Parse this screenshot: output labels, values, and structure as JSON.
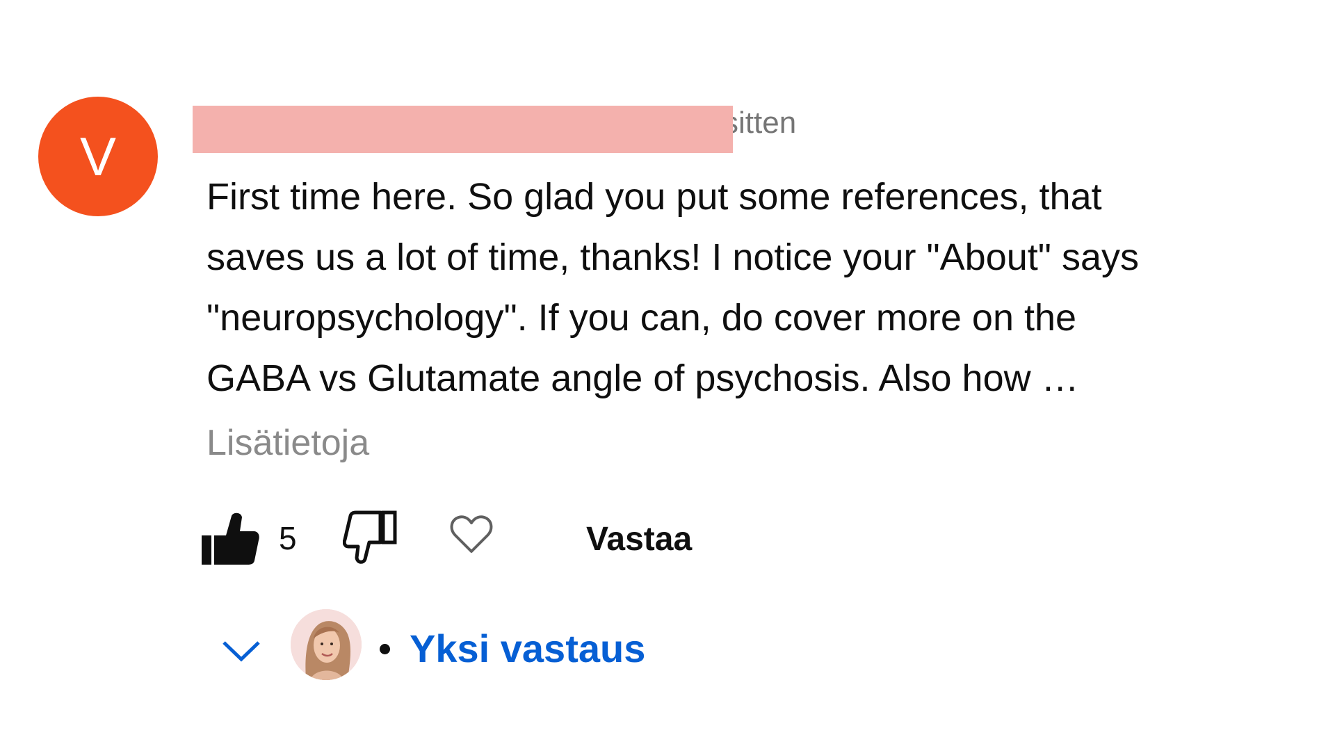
{
  "comment": {
    "avatar_letter": "V",
    "avatar_color": "#f4511e",
    "meta_visible_fragment": "sitten",
    "text": "First time here. So glad you put some references, that\nsaves us a lot of time, thanks! I notice your \"About\" says\n\"neuropsychology\". If you can, do cover more on the\nGABA vs Glutamate angle of psychosis. Also how …",
    "read_more_label": "Lisätietoja"
  },
  "actions": {
    "like_icon": "thumb-up-filled-icon",
    "like_count": "5",
    "dislike_icon": "thumb-down-outline-icon",
    "heart_icon": "heart-outline-icon",
    "reply_label": "Vastaa"
  },
  "replies": {
    "expand_icon": "chevron-down-icon",
    "creator_avatar_icon": "creator-avatar",
    "label": "Yksi vastaus",
    "link_color": "#065fd4"
  },
  "colors": {
    "text": "#0f0f0f",
    "muted": "#757575",
    "redaction": "#f4b1ad"
  }
}
